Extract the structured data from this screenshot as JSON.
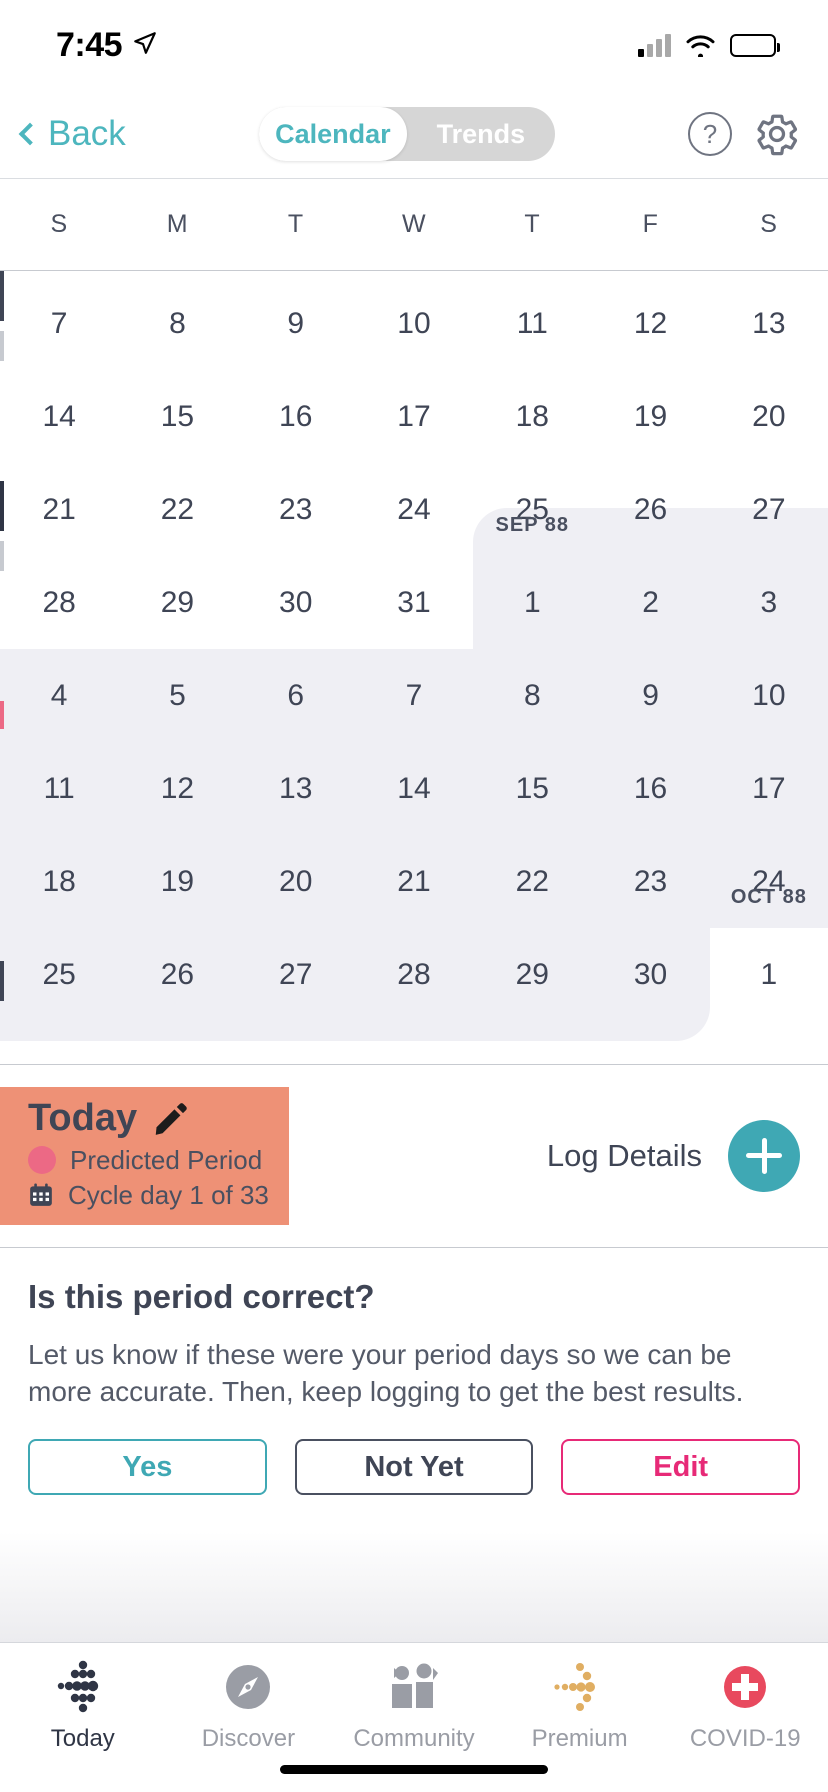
{
  "status_bar": {
    "time": "7:45",
    "location_icon": "location-arrow-icon",
    "signal_icon": "cellular-signal-icon",
    "wifi_icon": "wifi-icon",
    "battery_icon": "battery-icon"
  },
  "nav": {
    "back_label": "Back",
    "back_icon": "chevron-left-icon",
    "segments": [
      {
        "label": "Calendar",
        "active": true
      },
      {
        "label": "Trends",
        "active": false
      }
    ],
    "help_label": "?",
    "help_icon": "question-mark-circle-icon",
    "settings_icon": "gear-icon"
  },
  "calendar": {
    "weekdays": [
      "S",
      "M",
      "T",
      "W",
      "T",
      "F",
      "S"
    ],
    "month_labels": [
      {
        "text": "SEP 88",
        "row": 3,
        "col": 4
      },
      {
        "text": "OCT 88",
        "row": 7,
        "col": 6
      }
    ],
    "rows": [
      {
        "days": [
          "7",
          "8",
          "9",
          "10",
          "11",
          "12",
          "13"
        ],
        "shaded": [
          false,
          false,
          false,
          false,
          false,
          false,
          false
        ]
      },
      {
        "days": [
          "14",
          "15",
          "16",
          "17",
          "18",
          "19",
          "20"
        ],
        "shaded": [
          false,
          false,
          false,
          false,
          false,
          false,
          false
        ]
      },
      {
        "days": [
          "21",
          "22",
          "23",
          "24",
          "25",
          "26",
          "27"
        ],
        "shaded": [
          false,
          false,
          false,
          false,
          false,
          false,
          false
        ]
      },
      {
        "days": [
          "28",
          "29",
          "30",
          "31",
          "1",
          "2",
          "3"
        ],
        "shaded": [
          false,
          false,
          false,
          false,
          true,
          true,
          true
        ]
      },
      {
        "days": [
          "4",
          "5",
          "6",
          "7",
          "8",
          "9",
          "10"
        ],
        "shaded": [
          true,
          true,
          true,
          true,
          true,
          true,
          true
        ]
      },
      {
        "days": [
          "11",
          "12",
          "13",
          "14",
          "15",
          "16",
          "17"
        ],
        "shaded": [
          true,
          true,
          true,
          true,
          true,
          true,
          true
        ]
      },
      {
        "days": [
          "18",
          "19",
          "20",
          "21",
          "22",
          "23",
          "24"
        ],
        "shaded": [
          true,
          true,
          true,
          true,
          true,
          true,
          true
        ]
      },
      {
        "days": [
          "25",
          "26",
          "27",
          "28",
          "29",
          "30",
          "1"
        ],
        "shaded": [
          true,
          true,
          true,
          true,
          true,
          true,
          false
        ]
      }
    ]
  },
  "today_card": {
    "title": "Today",
    "edit_icon": "pencil-icon",
    "status_dot_icon": "period-dot-icon",
    "status_text": "Predicted Period",
    "cycle_icon": "calendar-icon",
    "cycle_text": "Cycle day 1 of 33",
    "background_color": "#EE9176",
    "dot_color": "#EC6985"
  },
  "log_details": {
    "label": "Log Details",
    "add_icon": "plus-icon",
    "add_color": "#3FA8B4"
  },
  "prompt": {
    "heading": "Is this period correct?",
    "body": "Let us know if these were your period days so we can be more accurate. Then, keep logging to get the best results.",
    "buttons": [
      {
        "label": "Yes",
        "color": "#3FA8B4"
      },
      {
        "label": "Not Yet",
        "color": "#3F4555"
      },
      {
        "label": "Edit",
        "color": "#E72A77"
      }
    ]
  },
  "tabbar": {
    "items": [
      {
        "label": "Today",
        "icon": "dot-diamond-icon",
        "active": true
      },
      {
        "label": "Discover",
        "icon": "compass-icon",
        "active": false
      },
      {
        "label": "Community",
        "icon": "people-icon",
        "active": false
      },
      {
        "label": "Premium",
        "icon": "gold-dots-arrow-icon",
        "active": false
      },
      {
        "label": "COVID-19",
        "icon": "red-cross-icon",
        "active": false
      }
    ]
  },
  "colors": {
    "accent_teal": "#4DB6BE",
    "shade_gray": "#EFEFF4",
    "text_dark": "#3F4555",
    "pink": "#E72A77",
    "covid_red": "#E8495E",
    "premium_gold": "#E0AE62"
  }
}
